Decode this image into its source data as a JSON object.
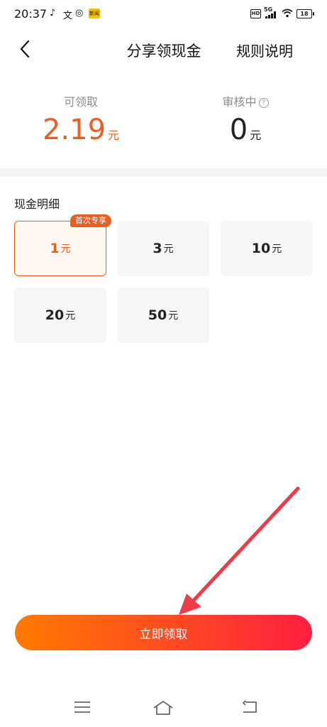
{
  "status_bar": {
    "time": "20:37",
    "news_badge": "新闻",
    "hd": "HD",
    "network": "5G",
    "battery": "18"
  },
  "header": {
    "title": "分享领现金",
    "rules_link": "规则说明"
  },
  "summary": {
    "available": {
      "label": "可领取",
      "value": "2.19",
      "unit": "元"
    },
    "reviewing": {
      "label": "审核中",
      "value": "0",
      "unit": "元",
      "help_glyph": "?"
    }
  },
  "cash_detail": {
    "title": "现金明细",
    "options": [
      {
        "amount": "1",
        "unit": "元",
        "badge": "首次专享",
        "selected": true
      },
      {
        "amount": "3",
        "unit": "元"
      },
      {
        "amount": "10",
        "unit": "元"
      },
      {
        "amount": "20",
        "unit": "元"
      },
      {
        "amount": "50",
        "unit": "元"
      }
    ]
  },
  "claim_button": {
    "label": "立即领取"
  },
  "colors": {
    "accent": "#ef5d1e",
    "gradient_start": "#ff7a00",
    "gradient_end": "#ff1f40",
    "annotation_arrow": "#ee3b48"
  },
  "icons": [
    "tiktok-icon",
    "translate-icon",
    "weibo-icon",
    "wifi-icon",
    "back-chevron-icon",
    "help-icon",
    "menu-icon",
    "home-icon",
    "back-icon"
  ]
}
